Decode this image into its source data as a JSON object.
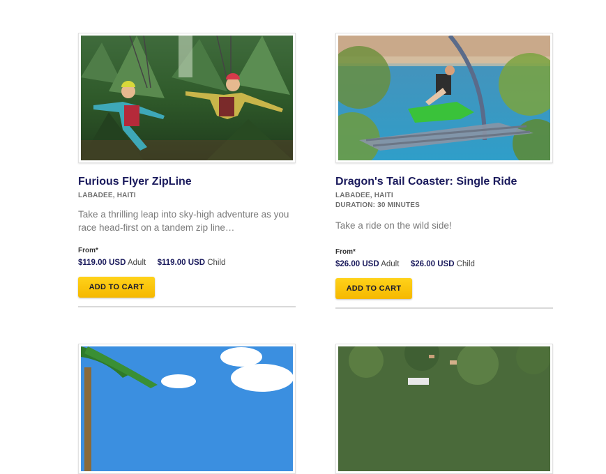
{
  "products": [
    {
      "title": "Furious Flyer ZipLine",
      "location": "LABADEE, HAITI",
      "duration": "",
      "description": "Take a thrilling leap into sky-high adventure as you race head-first on a tandem zip line…",
      "from_label": "From*",
      "adult_price": "$119.00 USD",
      "adult_label": "Adult",
      "child_price": "$119.00 USD",
      "child_label": "Child",
      "button_label": "ADD TO CART"
    },
    {
      "title": "Dragon's Tail Coaster: Single Ride",
      "location": "LABADEE, HAITI",
      "duration": "DURATION: 30 MINUTES",
      "description": "Take a ride on the wild side!",
      "from_label": "From*",
      "adult_price": "$26.00 USD",
      "adult_label": "Adult",
      "child_price": "$26.00 USD",
      "child_label": "Child",
      "button_label": "ADD TO CART"
    }
  ],
  "colors": {
    "title": "#1a1a5c",
    "button": "#ffc800",
    "meta": "#6e6e6e"
  }
}
